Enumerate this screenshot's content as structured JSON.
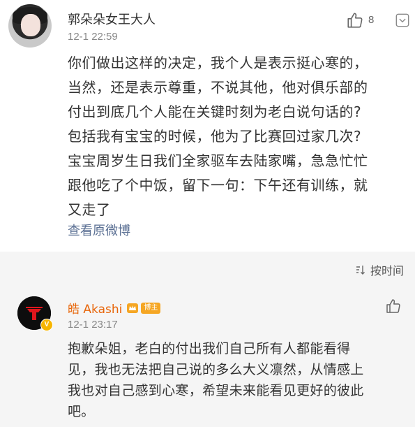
{
  "post": {
    "author": "郭朵朵女王大人",
    "time": "12-1 22:59",
    "like_count": "8",
    "text_lines": [
      "你们做出这样的决定，我个人是表示挺心寒的，",
      "当然，还是表示尊重，不说其他，他对俱乐部的",
      "付出到底几个人能在关键时刻为老白说句话的?",
      "包括我有宝宝的时候，他为了比赛回过家几次?",
      "宝宝周岁生日我们全家驱车去陆家嘴，急急忙忙",
      "跟他吃了个中饭，留下一句：下午还有训练，就",
      "又走了"
    ],
    "view_original": "查看原微博"
  },
  "comments_section": {
    "sort_label": "按时间",
    "comment": {
      "author": "皓 Akashi",
      "host_badge": "博主",
      "verify_mark": "V",
      "time": "12-1 23:17",
      "text_lines": [
        "抱歉朵姐，老白的付出我们自己所有人都能看得",
        "见，我也无法把自己说的多么大义凛然，从情感上",
        "我也对自己感到心寒，希望未来能看见更好的彼此",
        "吧。"
      ]
    }
  },
  "colors": {
    "link": "#5a6f93",
    "comment_author": "#e8660a",
    "badge": "#f5a623",
    "comments_bg": "#f5f5f5"
  },
  "icons": [
    "thumbs-up-icon",
    "chevron-down-icon",
    "sort-icon",
    "vip-crown-icon",
    "verified-icon"
  ]
}
